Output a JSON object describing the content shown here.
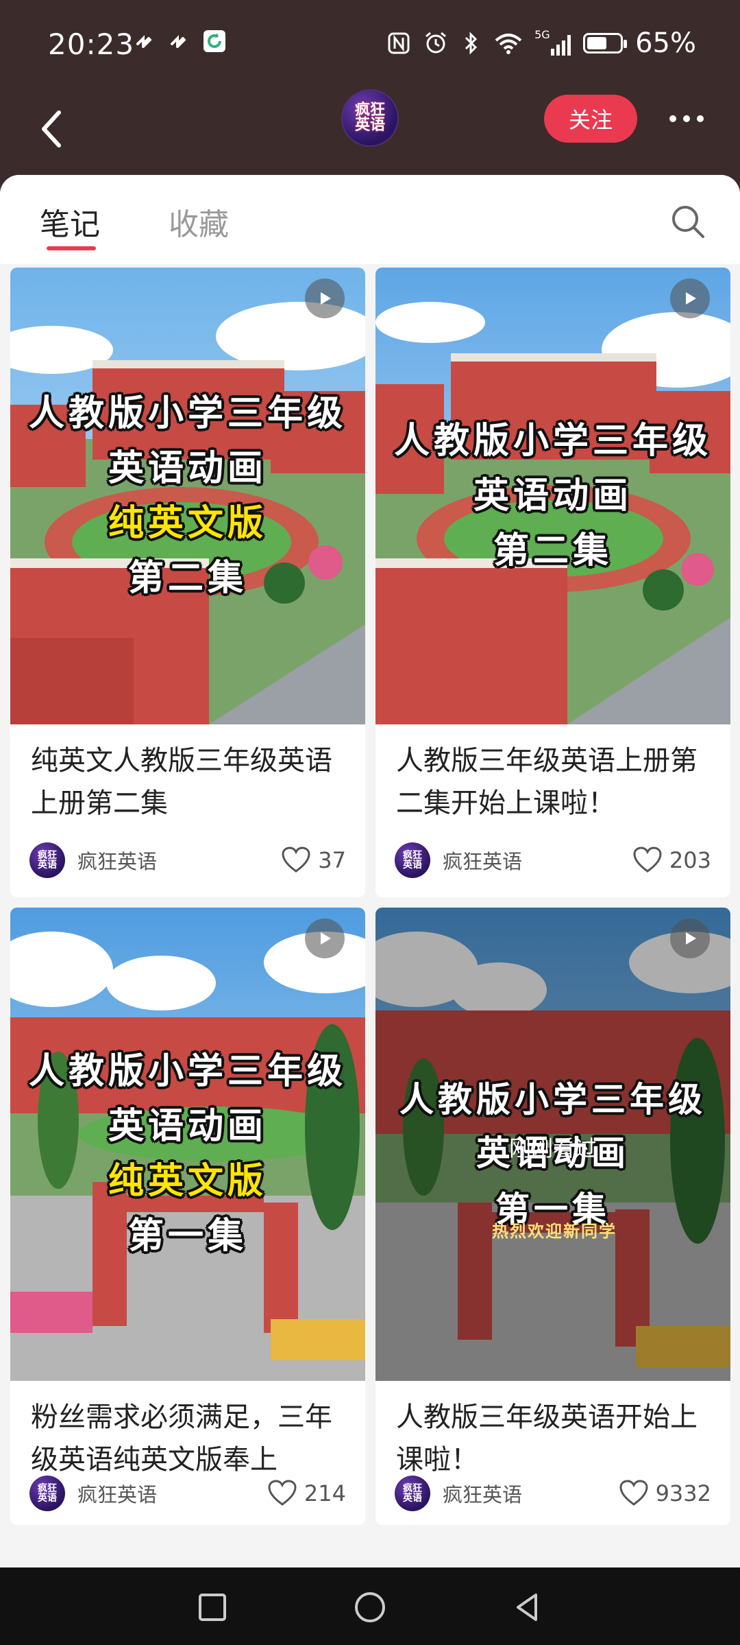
{
  "status_bar": {
    "time": "20:23",
    "battery_text": "65%",
    "battery_level": 0.65,
    "network": "5G",
    "icons": [
      "tiktok-icon",
      "tiktok-icon",
      "app-refresh-icon",
      "nfc-icon",
      "alarm-icon",
      "bluetooth-icon",
      "wifi-icon",
      "signal-icon",
      "battery-icon"
    ]
  },
  "header": {
    "avatar_text_line1": "疯狂",
    "avatar_text_line2": "英语",
    "follow_label": "关注"
  },
  "tabs": [
    {
      "label": "笔记",
      "active": true
    },
    {
      "label": "收藏",
      "active": false
    }
  ],
  "cards": [
    {
      "overlay": [
        "人教版小学三年级",
        "英语动画",
        "纯英文版",
        "第二集"
      ],
      "title": "纯英文人教版三年级英语上册第二集",
      "author": "疯狂英语",
      "likes": "37"
    },
    {
      "overlay": [
        "人教版小学三年级",
        "英语动画",
        "第二集"
      ],
      "title": "人教版三年级英语上册第二集开始上课啦！",
      "author": "疯狂英语",
      "likes": "203"
    },
    {
      "overlay": [
        "人教版小学三年级",
        "英语动画",
        "纯英文版",
        "第一集"
      ],
      "title": "粉丝需求必须满足，三年级英语纯英文版奉上",
      "author": "疯狂英语",
      "likes": "214"
    },
    {
      "overlay": [
        "人教版小学三年级",
        "英语动画",
        "第一集"
      ],
      "watched_label": "刚刚看过",
      "banner": "热烈欢迎新同学",
      "title": "人教版三年级英语开始上课啦！",
      "author": "疯狂英语",
      "likes": "9332"
    }
  ],
  "colors": {
    "accent": "#ea3a4f",
    "header_bg": "#3b2b2b",
    "overlay_yellow": "#ffe600"
  }
}
